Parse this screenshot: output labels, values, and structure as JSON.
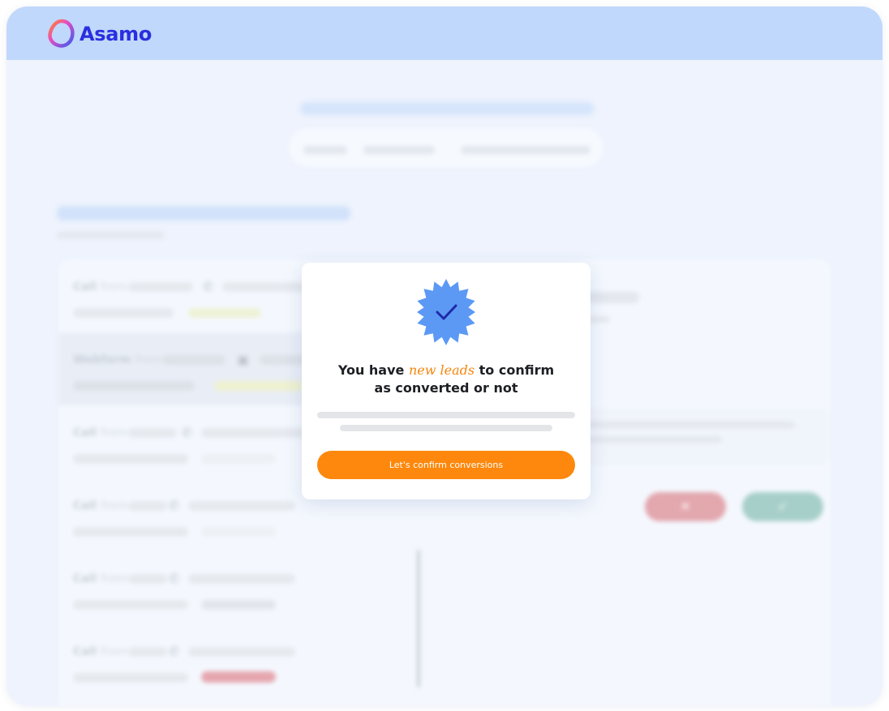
{
  "brand": {
    "name": "Asamo"
  },
  "background": {
    "rows": [
      {
        "type": "Call",
        "from": "from"
      },
      {
        "type": "Webform",
        "from": "from"
      },
      {
        "type": "Call",
        "from": "from"
      },
      {
        "type": "Call",
        "from": "from"
      },
      {
        "type": "Call",
        "from": "from"
      },
      {
        "type": "Call",
        "from": "from"
      }
    ],
    "reject_icon": "✕",
    "accept_icon": "✓"
  },
  "modal": {
    "title_before": "You have ",
    "title_accent": "new leads",
    "title_after": " to confirm",
    "title_line2": "as converted or not",
    "cta_label": "Let's confirm conversions"
  },
  "colors": {
    "accent": "#fd880d",
    "brand": "#2a2ee0",
    "badge": "#5b99f5",
    "topbar": "#c0d8fb"
  },
  "icons": [
    "asamo-logo-icon",
    "verified-badge-icon",
    "phone-icon",
    "calendar-icon",
    "close-icon",
    "check-icon"
  ]
}
